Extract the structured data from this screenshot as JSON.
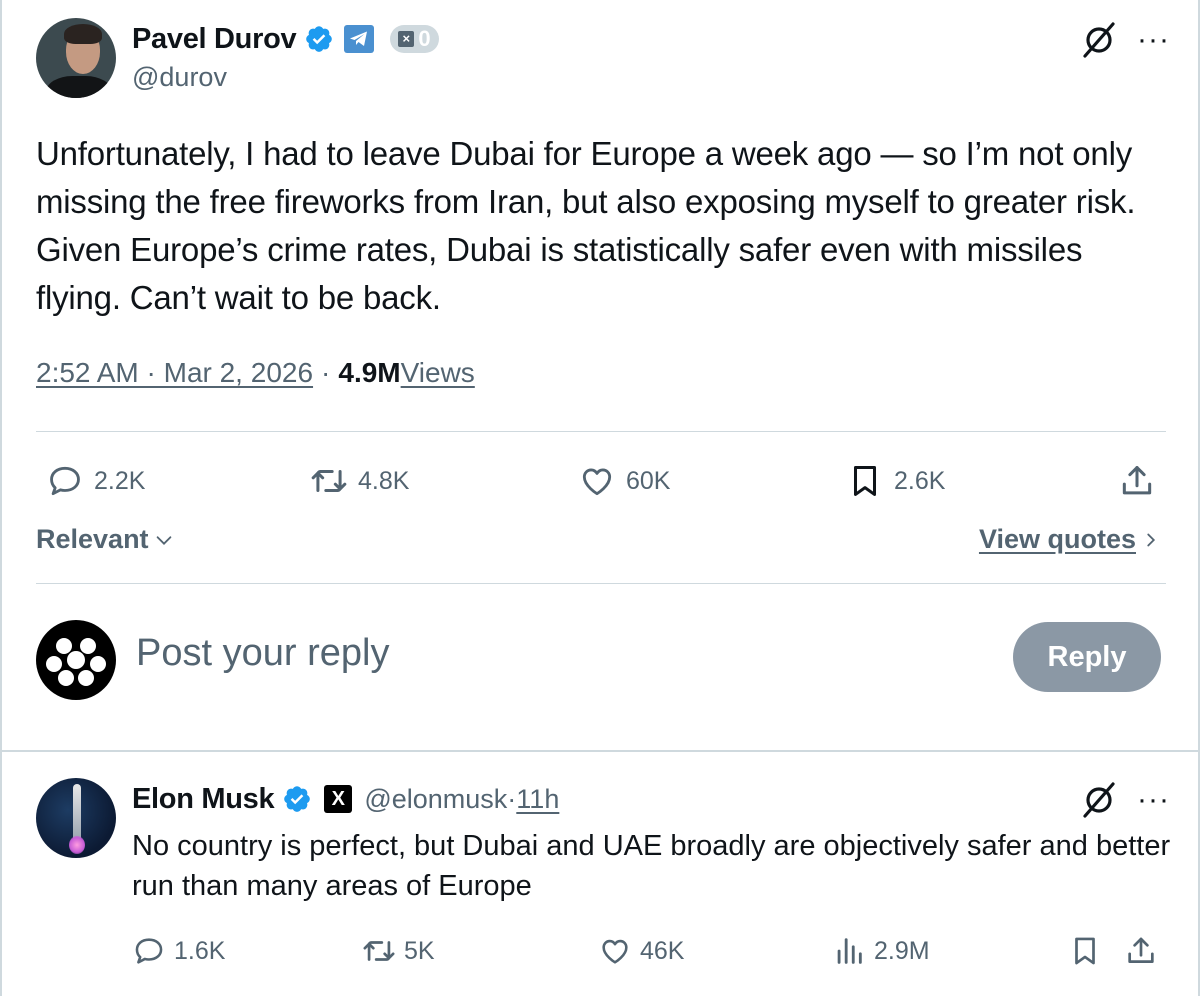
{
  "main_post": {
    "author_name": "Pavel Durov",
    "author_handle": "@durov",
    "badge_count": "0",
    "text": "Unfortunately, I had to leave Dubai for Europe a week ago — so I’m not only missing the free fireworks from Iran, but also exposing myself to greater risk. Given Europe’s crime rates, Dubai is statistically safer even with missiles flying. Can’t wait to be back.",
    "time": "2:52 AM · Mar 2, 2026",
    "separator": "·",
    "views_count": "4.9M",
    "views_label": " Views",
    "stats": {
      "replies": "2.2K",
      "reposts": "4.8K",
      "likes": "60K",
      "bookmarks": "2.6K"
    },
    "sort_label": "Relevant",
    "view_quotes_label": "View quotes",
    "reply_placeholder": "Post your reply",
    "reply_button": "Reply"
  },
  "reply_post": {
    "author_name": "Elon Musk",
    "x_badge": "X",
    "author_handle": "@elonmusk",
    "separator": " · ",
    "time": "11h",
    "text": "No country is perfect, but Dubai and UAE broadly are objectively safer and better run than many areas of Europe",
    "stats": {
      "replies": "1.6K",
      "reposts": "5K",
      "likes": "46K",
      "views": "2.9M"
    }
  },
  "icons": {
    "verified": "verified-badge-icon",
    "grok": "grok-icon",
    "more": "more-icon",
    "reply": "reply-icon",
    "repost": "repost-icon",
    "like": "like-icon",
    "bookmark": "bookmark-icon",
    "share": "share-icon",
    "views": "views-icon"
  },
  "colors": {
    "verified_blue": "#1d9bf0",
    "muted_text": "#536471",
    "divider": "#cfd9de",
    "reply_button_bg": "#8b98a5"
  }
}
